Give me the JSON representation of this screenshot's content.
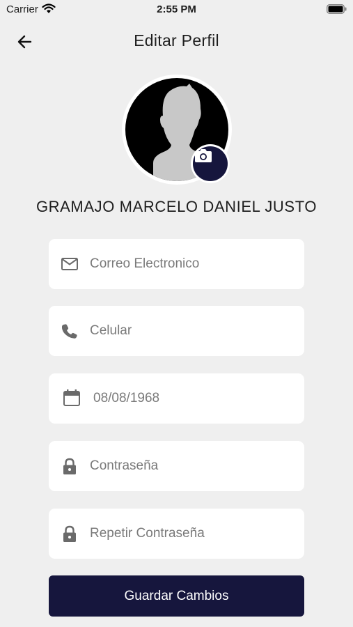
{
  "status_bar": {
    "carrier": "Carrier",
    "time": "2:55 PM"
  },
  "header": {
    "title": "Editar Perfil",
    "back_icon": "arrow-left-icon"
  },
  "profile": {
    "name": "GRAMAJO MARCELO DANIEL JUSTO",
    "camera_icon": "camera-icon"
  },
  "form": {
    "email": {
      "placeholder": "Correo Electronico",
      "icon": "mail-icon"
    },
    "phone": {
      "placeholder": "Celular",
      "icon": "phone-icon"
    },
    "birthdate": {
      "value": "08/08/1968",
      "icon": "calendar-icon"
    },
    "password": {
      "placeholder": "Contraseña",
      "icon": "lock-icon"
    },
    "repeat_password": {
      "placeholder": "Repetir Contraseña",
      "icon": "lock-icon"
    }
  },
  "save_button": {
    "label": "Guardar Cambios"
  },
  "colors": {
    "primary": "#16163d",
    "background": "#efefef",
    "field_bg": "#ffffff",
    "text_muted": "#7a7a7a"
  }
}
